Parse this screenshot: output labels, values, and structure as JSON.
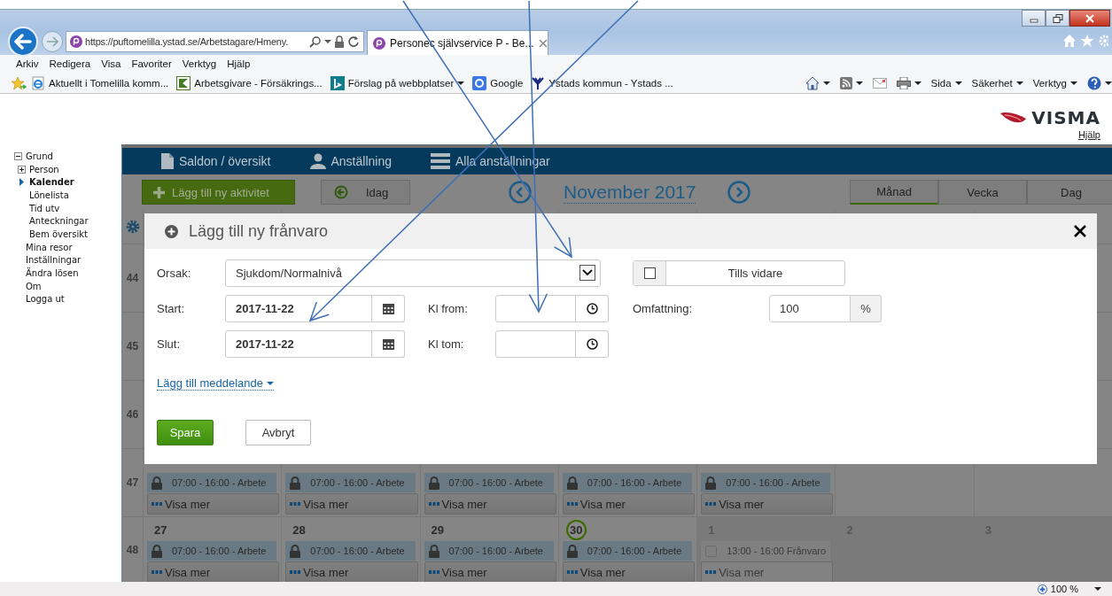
{
  "browser": {
    "url": "https://puftomelilla.ystad.se/Arbetstagare/Hmeny.",
    "tab": "Personec självservice P - Be...",
    "menu": [
      "Arkiv",
      "Redigera",
      "Visa",
      "Favoriter",
      "Verktyg",
      "Hjälp"
    ],
    "favorites": [
      {
        "kind": "ie",
        "label": "Aktuellt i Tomelilla komm...",
        "dropdown": false
      },
      {
        "kind": "flag",
        "label": "Arbetsgivare - Försäkrings...",
        "dropdown": false
      },
      {
        "kind": "bing",
        "label": "Förslag på webbplatser",
        "dropdown": true
      },
      {
        "kind": "google",
        "label": "Google",
        "dropdown": false
      },
      {
        "kind": "ystad",
        "label": "Ystads kommun - Ystads ...",
        "dropdown": false
      }
    ],
    "commands": [
      {
        "kind": "home"
      },
      {
        "kind": "feed"
      },
      {
        "kind": "mail"
      },
      {
        "kind": "print"
      },
      {
        "kind": "menu",
        "label": "Sida"
      },
      {
        "kind": "menu",
        "label": "Säkerhet"
      },
      {
        "kind": "menu",
        "label": "Verktyg"
      },
      {
        "kind": "help"
      }
    ],
    "zoom": "100 %"
  },
  "header": {
    "logo": "VISMA",
    "help_link": "Hjälp"
  },
  "sidebar": {
    "items": [
      {
        "label": "Grund",
        "expanded": true,
        "selected": false,
        "children": [
          {
            "label": "Person",
            "expanded": false,
            "selected": false
          },
          {
            "label": "Kalender",
            "selected": true
          },
          {
            "label": "Lönelista",
            "selected": false
          },
          {
            "label": "Tid utv",
            "selected": false
          },
          {
            "label": "Anteckningar",
            "selected": false
          },
          {
            "label": "Bem översikt",
            "selected": false
          }
        ]
      },
      {
        "label": "Mina resor",
        "selected": false
      },
      {
        "label": "Inställningar",
        "selected": false
      },
      {
        "label": "Ändra lösen",
        "selected": false
      },
      {
        "label": "Om",
        "selected": false
      },
      {
        "label": "Logga ut",
        "selected": false
      }
    ]
  },
  "app": {
    "nav": [
      {
        "kind": "document",
        "label": "Saldon / översikt"
      },
      {
        "kind": "person",
        "label": "Anställning"
      },
      {
        "kind": "list",
        "label": "Alla anställningar"
      }
    ],
    "toolbar": {
      "add": "Lägg till ny aktivitet",
      "today": "Idag",
      "month": "November 2017",
      "views": [
        {
          "label": "Månad",
          "selected": true
        },
        {
          "label": "Vecka",
          "selected": false
        },
        {
          "label": "Dag",
          "selected": false
        }
      ]
    },
    "calendar": {
      "weeks": [
        {
          "number": "44"
        },
        {
          "number": "45"
        },
        {
          "number": "46"
        },
        {
          "number": "47",
          "days": [
            {
              "events": [
                {
                  "kind": "locked",
                  "text": "07:00 - 16:00 - Arbete"
                }
              ],
              "more": "Visa mer"
            },
            {
              "events": [
                {
                  "kind": "locked",
                  "text": "07:00 - 16:00 - Arbete"
                }
              ],
              "more": "Visa mer"
            },
            {
              "events": [
                {
                  "kind": "locked",
                  "text": "07:00 - 16:00 - Arbete"
                }
              ],
              "more": "Visa mer"
            },
            {
              "events": [
                {
                  "kind": "locked",
                  "text": "07:00 - 16:00 - Arbete"
                }
              ],
              "more": "Visa mer"
            },
            {
              "events": [
                {
                  "kind": "locked",
                  "text": "07:00 - 16:00 - Arbete"
                }
              ],
              "more": "Visa mer"
            }
          ]
        },
        {
          "number": "48",
          "days": [
            {
              "date": "27",
              "today": false,
              "outside_month": false,
              "events": [
                {
                  "kind": "locked",
                  "text": "07:00 - 16:00 - Arbete"
                }
              ],
              "more": "Visa mer"
            },
            {
              "date": "28",
              "today": false,
              "outside_month": false,
              "events": [
                {
                  "kind": "locked",
                  "text": "07:00 - 16:00 - Arbete"
                }
              ],
              "more": "Visa mer"
            },
            {
              "date": "29",
              "today": false,
              "outside_month": false,
              "events": [
                {
                  "kind": "locked",
                  "text": "07:00 - 16:00 - Arbete"
                }
              ],
              "more": "Visa mer"
            },
            {
              "date": "30",
              "today": true,
              "outside_month": false,
              "events": [
                {
                  "kind": "locked",
                  "text": "07:00 - 16:00 - Arbete"
                }
              ],
              "more": "Visa mer"
            },
            {
              "date": "1",
              "today": false,
              "outside_month": true,
              "events": [
                {
                  "kind": "absence",
                  "text": "13:00 - 16:00 Frånvaro"
                }
              ],
              "more": "Visa mer"
            },
            {
              "date": "2",
              "today": false,
              "outside_month": true
            },
            {
              "date": "3",
              "today": false,
              "outside_month": true
            }
          ]
        }
      ]
    }
  },
  "modal": {
    "title": "Lägg till ny frånvaro",
    "reason": {
      "label": "Orsak:",
      "value": "Sjukdom/Normalnivå"
    },
    "until_further": {
      "label": "Tills vidare",
      "checked": false
    },
    "start": {
      "label": "Start:",
      "value": "2017-11-22"
    },
    "time_from": {
      "label": "Kl from:"
    },
    "extent": {
      "label": "Omfattning:",
      "value": "100",
      "unit": "%"
    },
    "end": {
      "label": "Slut:",
      "value": "2017-11-22"
    },
    "time_to": {
      "label": "Kl tom:"
    },
    "message_link": "Lägg till meddelande",
    "save": "Spara",
    "cancel": "Avbryt"
  }
}
